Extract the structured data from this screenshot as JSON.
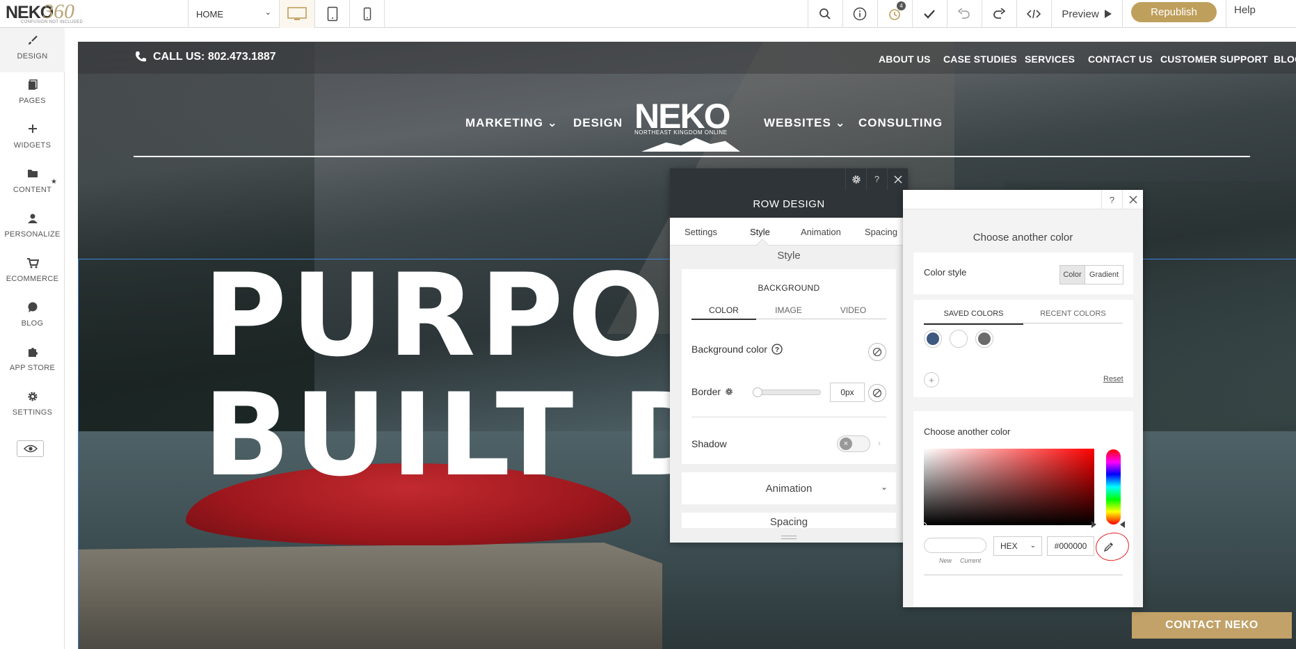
{
  "toolbar": {
    "logo_main": "NEKO",
    "logo_num": "360",
    "logo_tagline": "CONFUSION NOT INCLUDED",
    "page_select": "HOME",
    "notification_count": "4",
    "preview_label": "Preview",
    "republish_label": "Republish",
    "help_label": "Help"
  },
  "sidebar": {
    "items": [
      {
        "label": "DESIGN",
        "icon": "brush-icon"
      },
      {
        "label": "PAGES",
        "icon": "pages-icon"
      },
      {
        "label": "WIDGETS",
        "icon": "plus-icon"
      },
      {
        "label": "CONTENT",
        "icon": "folder-icon"
      },
      {
        "label": "PERSONALIZE",
        "icon": "person-icon"
      },
      {
        "label": "ECOMMERCE",
        "icon": "cart-icon"
      },
      {
        "label": "BLOG",
        "icon": "chat-icon"
      },
      {
        "label": "APP STORE",
        "icon": "puzzle-icon"
      },
      {
        "label": "SETTINGS",
        "icon": "gear-icon"
      }
    ],
    "content_star": "★"
  },
  "site": {
    "call": "CALL US: 802.473.1887",
    "top_nav": [
      "ABOUT US",
      "CASE STUDIES",
      "SERVICES",
      "CONTACT US",
      "CUSTOMER SUPPORT",
      "BLOG"
    ],
    "main_nav": {
      "marketing": "MARKETING",
      "design": "DESIGN",
      "websites": "WEBSITES",
      "consulting": "CONSULTING"
    },
    "logo_big": "NEKO",
    "logo_sub": "NORTHEAST KINGDOM ONLINE",
    "hero_line1": "PURPOS",
    "hero_line2": "BUILT DI",
    "contact_button": "CONTACT NEKO"
  },
  "row_design": {
    "title": "ROW DESIGN",
    "tabs": [
      "Settings",
      "Style",
      "Animation",
      "Spacing"
    ],
    "section": "Style",
    "background_title": "BACKGROUND",
    "bg_tabs": [
      "COLOR",
      "IMAGE",
      "VIDEO"
    ],
    "background_color_label": "Background color",
    "border_label": "Border",
    "border_value": "0px",
    "shadow_label": "Shadow",
    "animation_label": "Animation",
    "spacing_label": "Spacing"
  },
  "color_picker": {
    "title": "Choose another color",
    "color_style_label": "Color style",
    "style_color": "Color",
    "style_gradient": "Gradient",
    "tab_saved": "SAVED COLORS",
    "tab_recent": "RECENT COLORS",
    "swatches": [
      "#3f5a80",
      "#ffffff",
      "#6b6b6b"
    ],
    "reset_label": "Reset",
    "choose_label": "Choose another color",
    "label_new": "New",
    "label_current": "Current",
    "format": "HEX",
    "hex_value": "#000000"
  },
  "colors": {
    "accent_gold": "#bf9f5c",
    "panel_dark": "#2e3437",
    "selection_blue": "#3b84e0",
    "annotation_red": "#e02020"
  }
}
